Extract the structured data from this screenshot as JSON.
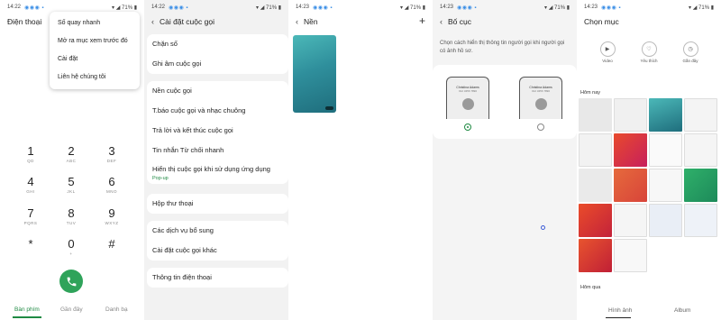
{
  "status": {
    "p1": {
      "time": "14:22",
      "battery": "71%"
    },
    "p2": {
      "time": "14:22",
      "battery": "71%"
    },
    "p3": {
      "time": "14:23",
      "battery": "71%"
    },
    "p4": {
      "time": "14:23",
      "battery": "71%"
    },
    "p5": {
      "time": "14:23",
      "battery": "71%"
    }
  },
  "dialer": {
    "title": "Điện thoại",
    "menu": [
      "Số quay nhanh",
      "Mở ra mục xem trước đó",
      "Cài đặt",
      "Liên hệ chúng tôi"
    ],
    "keys": [
      {
        "num": "1",
        "sub": "QD"
      },
      {
        "num": "2",
        "sub": "ABC"
      },
      {
        "num": "3",
        "sub": "DEF"
      },
      {
        "num": "4",
        "sub": "GHI"
      },
      {
        "num": "5",
        "sub": "JKL"
      },
      {
        "num": "6",
        "sub": "MNO"
      },
      {
        "num": "7",
        "sub": "PQRS"
      },
      {
        "num": "8",
        "sub": "TUV"
      },
      {
        "num": "9",
        "sub": "WXYZ"
      },
      {
        "num": "*",
        "sub": ""
      },
      {
        "num": "0",
        "sub": "+"
      },
      {
        "num": "#",
        "sub": ""
      }
    ],
    "tabs": [
      "Bàn phím",
      "Gần đây",
      "Danh bạ"
    ],
    "accent": "#1f8a43"
  },
  "call_settings": {
    "title": "Cài đặt cuộc gọi",
    "group1": [
      "Chặn số",
      "Ghi âm cuộc gọi"
    ],
    "group2": [
      "Nền cuộc gọi",
      "T.báo cuộc gọi và nhạc chuông",
      "Trả lời và kết thúc cuộc gọi",
      "Tin nhắn Từ chối nhanh"
    ],
    "popup_row": {
      "label": "Hiển thị cuộc gọi khi sử dụng ứng dụng",
      "sub": "Pop-up"
    },
    "group3": [
      "Hộp thư thoại"
    ],
    "group4": [
      "Các dịch vụ bổ sung",
      "Cài đặt cuộc gọi khác"
    ],
    "group5": [
      "Thông tin điện thoại"
    ]
  },
  "background": {
    "title": "Nền",
    "plus_icon": "+"
  },
  "layout": {
    "title": "Bố cục",
    "description": "Chọn cách hiển thị thông tin người gọi khi người gọi có ảnh hồ sơ.",
    "mock_name": "Christina Adams",
    "mock_phone": "012 3456 7890"
  },
  "picker": {
    "title": "Chọn mục",
    "sources": [
      "Video",
      "Yêu thích",
      "Gần đây"
    ],
    "today": "Hôm nay",
    "yesterday": "Hôm qua",
    "tabs": [
      "Hình ảnh",
      "Album"
    ]
  }
}
